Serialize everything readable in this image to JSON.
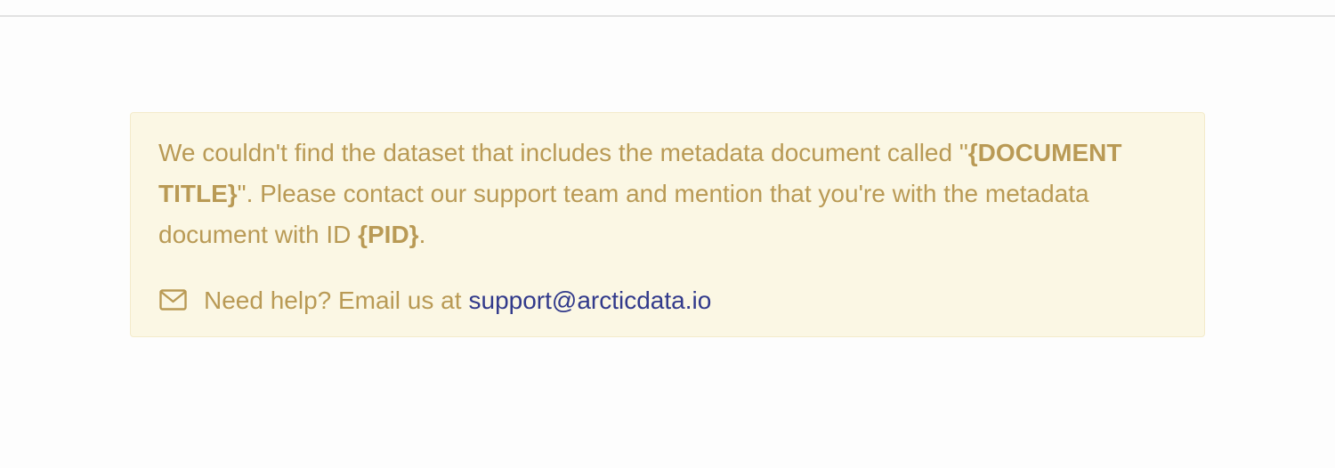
{
  "alert": {
    "message_part1": "We couldn't find the dataset that includes the metadata document called \"",
    "document_title": "{DOCUMENT TITLE}",
    "message_part2": "\". Please contact our support team and mention that you're with the metadata document with ID ",
    "pid": "{PID}",
    "message_part3": ".",
    "help_icon": "envelope-icon",
    "help_text": "Need help? Email us at",
    "support_email": "support@arcticdata.io"
  },
  "colors": {
    "alert_background": "#fbf7e4",
    "alert_border": "#f3ebcb",
    "alert_text": "#b99a55",
    "link": "#323a8b"
  }
}
